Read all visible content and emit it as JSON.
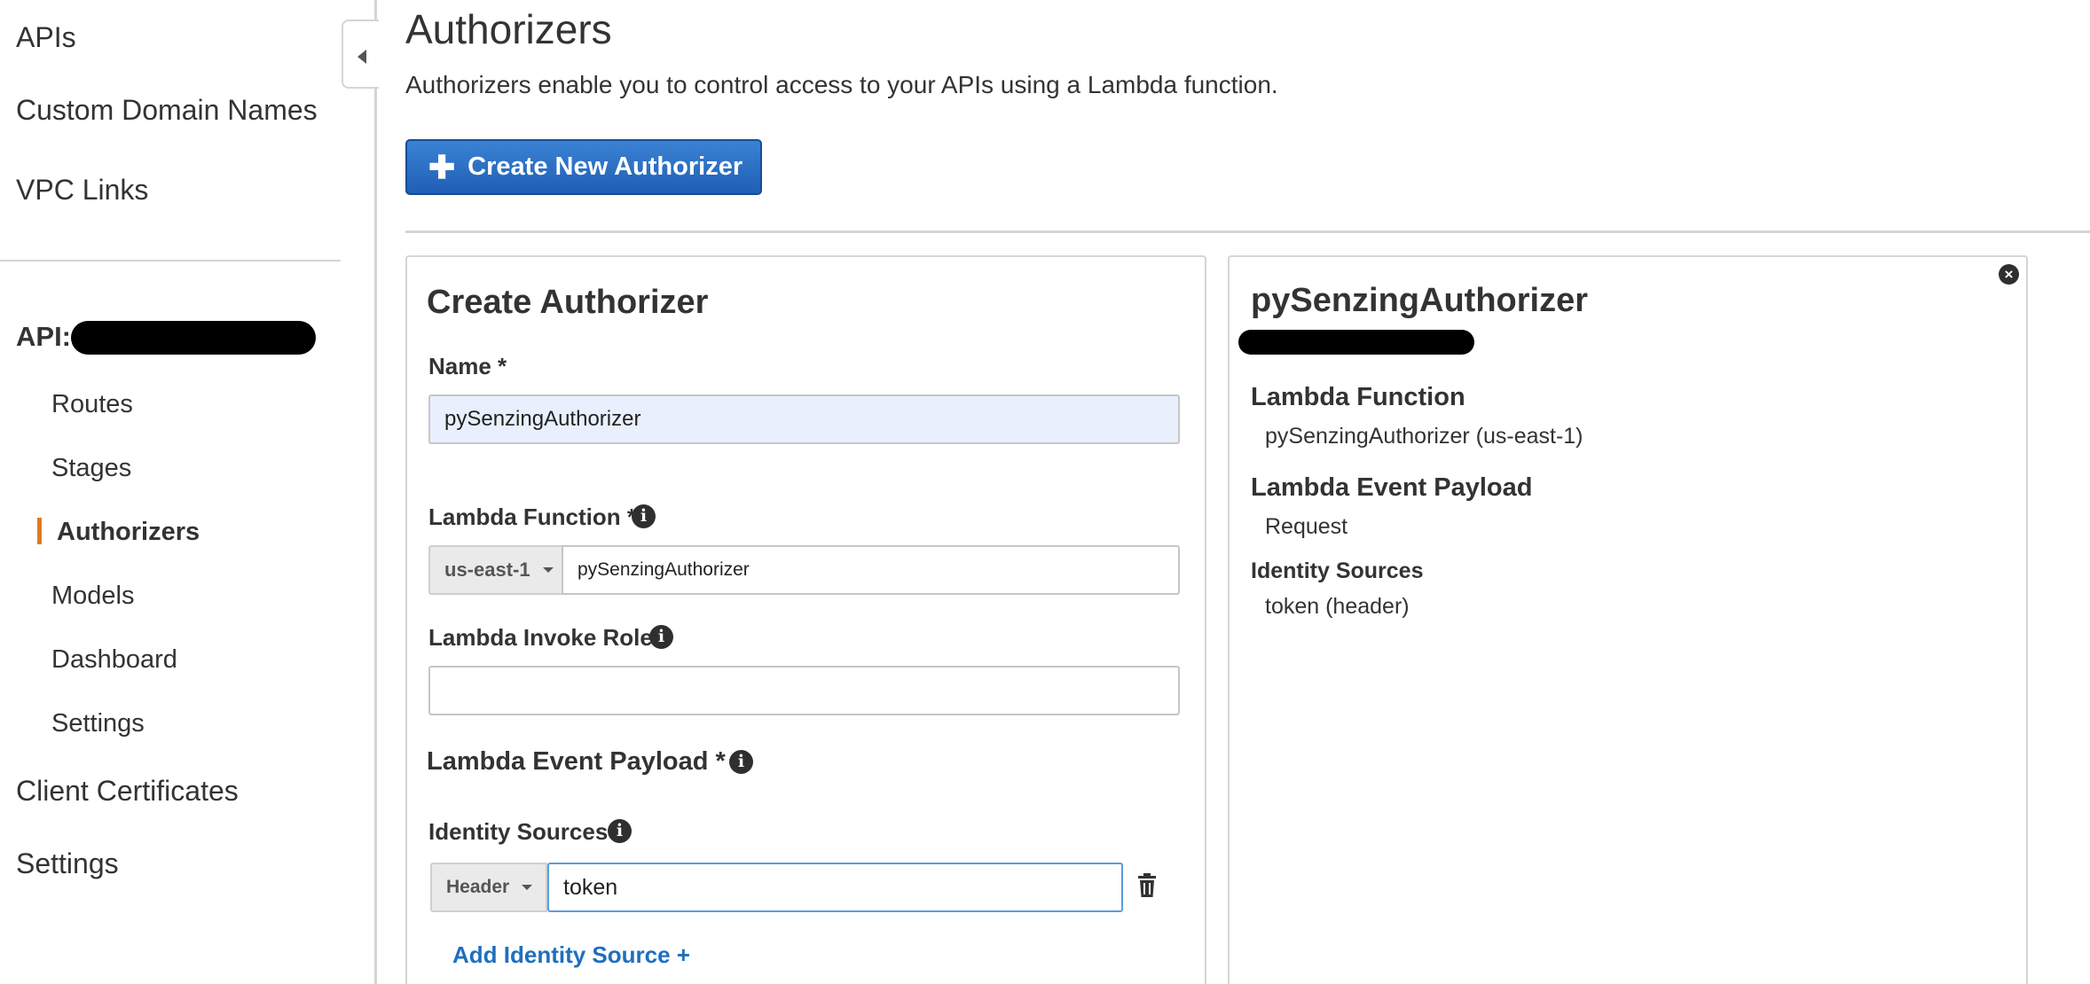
{
  "sidebar": {
    "top_links": [
      {
        "label": "APIs"
      },
      {
        "label": "Custom Domain Names"
      },
      {
        "label": "VPC Links"
      }
    ],
    "api_label": "API:",
    "api_items": [
      {
        "label": "Routes"
      },
      {
        "label": "Stages"
      },
      {
        "label": "Authorizers",
        "active": true
      },
      {
        "label": "Models"
      },
      {
        "label": "Dashboard"
      },
      {
        "label": "Settings"
      }
    ],
    "bottom_links": [
      {
        "label": "Client Certificates"
      },
      {
        "label": "Settings"
      }
    ],
    "active_color": "#e07b1f"
  },
  "header": {
    "title": "Authorizers",
    "description": "Authorizers enable you to control access to your APIs using a Lambda function.",
    "create_button": "Create New Authorizer",
    "create_button_icon": "plus-icon",
    "button_color": "#2a6ec6"
  },
  "form": {
    "title": "Create Authorizer",
    "name_label": "Name *",
    "name_value": "pySenzingAuthorizer",
    "lambda_function_label": "Lambda Function *",
    "region_value": "us-east-1",
    "function_value": "pySenzingAuthorizer",
    "invoke_role_label": "Lambda Invoke Role",
    "invoke_role_value": "",
    "event_payload_label": "Lambda Event Payload *",
    "identity_sources_label": "Identity Sources",
    "identity_source_type": "Header",
    "identity_source_value": "token",
    "add_identity_source": "Add Identity Source +"
  },
  "details": {
    "title": "pySenzingAuthorizer",
    "lambda_function_heading": "Lambda Function",
    "lambda_function_value": "pySenzingAuthorizer (us-east-1)",
    "event_payload_heading": "Lambda Event Payload",
    "event_payload_value": "Request",
    "identity_sources_heading": "Identity Sources",
    "identity_sources_value": "token (header)"
  }
}
